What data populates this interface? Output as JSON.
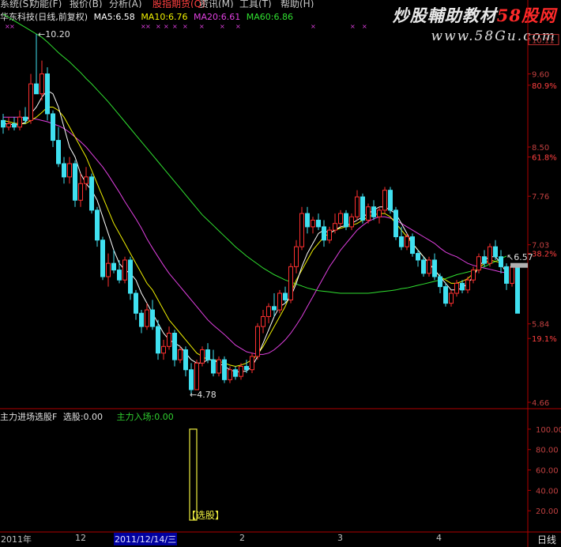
{
  "menu": [
    {
      "label": "系统",
      "x": 0
    },
    {
      "label": "功能",
      "x": 38
    },
    {
      "label": "报价",
      "x": 88
    },
    {
      "label": "分析",
      "x": 138
    },
    {
      "label": "股指期货",
      "x": 193,
      "active": true
    },
    {
      "label": "资讯",
      "x": 252
    },
    {
      "label": "工具",
      "x": 303
    },
    {
      "label": "帮助",
      "x": 355
    }
  ],
  "watermark": {
    "line1_a": "炒股輔助教材",
    "line1_b": "58股网",
    "line2": "www.58Gu.com"
  },
  "header": {
    "title": "华东科技(日线,前复权)",
    "ma5": "MA5:6.58",
    "ma10": "MA10:6.76",
    "ma20": "MA20:6.61",
    "ma60": "MA60:6.86"
  },
  "colors": {
    "up": "#ff3030",
    "down": "#40e0f0",
    "ma5": "#ffffff",
    "ma10": "#f0f000",
    "ma20": "#e040e0",
    "ma60": "#30e030",
    "axis": "#b00000",
    "grid": "#5a0000",
    "ind_title": "#e0e0e0",
    "ind_green": "#30d030",
    "bar": "#f0f040"
  },
  "price_axis": [
    {
      "label": "10.11",
      "price": 10.11,
      "boxed": true
    },
    {
      "label": "9.60",
      "price": 9.6
    },
    {
      "label": "80.9%",
      "price": 9.43
    },
    {
      "label": "8.50",
      "price": 8.5
    },
    {
      "label": "61.8%",
      "price": 8.35
    },
    {
      "label": "7.76",
      "price": 7.76
    },
    {
      "label": "7.03",
      "price": 7.03
    },
    {
      "label": "38.2%",
      "price": 6.9
    },
    {
      "label": "5.84",
      "price": 5.84
    },
    {
      "label": "19.1%",
      "price": 5.62
    },
    {
      "label": "4.66",
      "price": 4.66
    }
  ],
  "annotations": {
    "high": "10.20",
    "low": "4.78",
    "last": "6.57"
  },
  "indicator": {
    "title": "主力进场选股F",
    "xuangu": "选股:0.00",
    "zhuli": "主力入场:0.00",
    "axis": [
      "100.00",
      "80.00",
      "60.00",
      "40.00",
      "20.00"
    ],
    "bar_label": "【选股】",
    "bar_value": 100
  },
  "date_axis": {
    "ticks": [
      {
        "label": "2011年",
        "x": 1
      },
      {
        "label": "12",
        "x": 95
      },
      {
        "label": "2",
        "x": 303
      },
      {
        "label": "3",
        "x": 427
      },
      {
        "label": "4",
        "x": 552
      }
    ],
    "selected": "2011/12/14/三",
    "period": "日线"
  },
  "chart_data": {
    "type": "candlestick",
    "y_range": [
      4.6,
      10.45
    ],
    "candles": [
      {
        "o": 8.9,
        "h": 9.0,
        "l": 8.7,
        "c": 8.8
      },
      {
        "o": 8.8,
        "h": 8.95,
        "l": 8.75,
        "c": 8.85
      },
      {
        "o": 8.85,
        "h": 8.95,
        "l": 8.75,
        "c": 8.8
      },
      {
        "o": 8.8,
        "h": 9.05,
        "l": 8.75,
        "c": 8.95
      },
      {
        "o": 8.95,
        "h": 9.1,
        "l": 8.85,
        "c": 8.9
      },
      {
        "o": 8.9,
        "h": 9.6,
        "l": 8.85,
        "c": 9.45
      },
      {
        "o": 9.45,
        "h": 10.2,
        "l": 9.3,
        "c": 9.3
      },
      {
        "o": 9.3,
        "h": 9.8,
        "l": 9.2,
        "c": 9.6
      },
      {
        "o": 9.6,
        "h": 9.7,
        "l": 8.9,
        "c": 9.0
      },
      {
        "o": 9.0,
        "h": 9.05,
        "l": 8.5,
        "c": 8.6
      },
      {
        "o": 8.6,
        "h": 8.8,
        "l": 8.2,
        "c": 8.25
      },
      {
        "o": 8.25,
        "h": 8.35,
        "l": 7.95,
        "c": 8.05
      },
      {
        "o": 8.05,
        "h": 8.35,
        "l": 7.95,
        "c": 8.25
      },
      {
        "o": 8.25,
        "h": 8.3,
        "l": 7.6,
        "c": 7.7
      },
      {
        "o": 7.7,
        "h": 8.1,
        "l": 7.6,
        "c": 7.95
      },
      {
        "o": 7.95,
        "h": 8.2,
        "l": 7.85,
        "c": 8.05
      },
      {
        "o": 8.05,
        "h": 8.1,
        "l": 7.5,
        "c": 7.55
      },
      {
        "o": 7.55,
        "h": 7.6,
        "l": 7.0,
        "c": 7.1
      },
      {
        "o": 7.1,
        "h": 7.15,
        "l": 6.5,
        "c": 6.55
      },
      {
        "o": 6.55,
        "h": 6.9,
        "l": 6.4,
        "c": 6.75
      },
      {
        "o": 6.75,
        "h": 6.95,
        "l": 6.6,
        "c": 6.65
      },
      {
        "o": 6.65,
        "h": 6.8,
        "l": 6.45,
        "c": 6.5
      },
      {
        "o": 6.5,
        "h": 6.85,
        "l": 6.45,
        "c": 6.8
      },
      {
        "o": 6.8,
        "h": 6.85,
        "l": 6.2,
        "c": 6.3
      },
      {
        "o": 6.3,
        "h": 6.35,
        "l": 5.9,
        "c": 6.0
      },
      {
        "o": 6.0,
        "h": 6.05,
        "l": 5.7,
        "c": 5.8
      },
      {
        "o": 5.8,
        "h": 6.15,
        "l": 5.75,
        "c": 6.05
      },
      {
        "o": 6.05,
        "h": 6.2,
        "l": 5.75,
        "c": 5.8
      },
      {
        "o": 5.8,
        "h": 5.9,
        "l": 5.3,
        "c": 5.4
      },
      {
        "o": 5.4,
        "h": 5.6,
        "l": 5.3,
        "c": 5.5
      },
      {
        "o": 5.5,
        "h": 5.8,
        "l": 5.45,
        "c": 5.7
      },
      {
        "o": 5.7,
        "h": 5.75,
        "l": 5.2,
        "c": 5.3
      },
      {
        "o": 5.3,
        "h": 5.5,
        "l": 5.25,
        "c": 5.45
      },
      {
        "o": 5.45,
        "h": 5.5,
        "l": 5.05,
        "c": 5.15
      },
      {
        "o": 5.15,
        "h": 5.25,
        "l": 4.78,
        "c": 4.85
      },
      {
        "o": 4.85,
        "h": 5.3,
        "l": 4.85,
        "c": 5.25
      },
      {
        "o": 5.25,
        "h": 5.5,
        "l": 5.2,
        "c": 5.45
      },
      {
        "o": 5.45,
        "h": 5.55,
        "l": 5.25,
        "c": 5.3
      },
      {
        "o": 5.3,
        "h": 5.45,
        "l": 5.05,
        "c": 5.1
      },
      {
        "o": 5.1,
        "h": 5.35,
        "l": 5.05,
        "c": 5.3
      },
      {
        "o": 5.3,
        "h": 5.35,
        "l": 4.95,
        "c": 5.0
      },
      {
        "o": 5.0,
        "h": 5.2,
        "l": 4.95,
        "c": 5.15
      },
      {
        "o": 5.15,
        "h": 5.2,
        "l": 5.0,
        "c": 5.05
      },
      {
        "o": 5.05,
        "h": 5.25,
        "l": 5.0,
        "c": 5.2
      },
      {
        "o": 5.2,
        "h": 5.3,
        "l": 5.1,
        "c": 5.15
      },
      {
        "o": 5.15,
        "h": 5.4,
        "l": 5.1,
        "c": 5.35
      },
      {
        "o": 5.35,
        "h": 5.85,
        "l": 5.3,
        "c": 5.8
      },
      {
        "o": 5.8,
        "h": 6.05,
        "l": 5.7,
        "c": 5.95
      },
      {
        "o": 5.95,
        "h": 6.15,
        "l": 5.85,
        "c": 6.1
      },
      {
        "o": 6.1,
        "h": 6.3,
        "l": 5.95,
        "c": 6.05
      },
      {
        "o": 6.05,
        "h": 6.35,
        "l": 6.0,
        "c": 6.3
      },
      {
        "o": 6.3,
        "h": 6.4,
        "l": 6.15,
        "c": 6.2
      },
      {
        "o": 6.2,
        "h": 6.75,
        "l": 6.15,
        "c": 6.7
      },
      {
        "o": 6.7,
        "h": 7.1,
        "l": 6.6,
        "c": 7.0
      },
      {
        "o": 7.0,
        "h": 7.6,
        "l": 6.95,
        "c": 7.5
      },
      {
        "o": 7.5,
        "h": 7.6,
        "l": 7.2,
        "c": 7.3
      },
      {
        "o": 7.3,
        "h": 7.45,
        "l": 7.2,
        "c": 7.4
      },
      {
        "o": 7.4,
        "h": 7.5,
        "l": 7.25,
        "c": 7.3
      },
      {
        "o": 7.3,
        "h": 7.4,
        "l": 7.0,
        "c": 7.1
      },
      {
        "o": 7.1,
        "h": 7.3,
        "l": 7.05,
        "c": 7.25
      },
      {
        "o": 7.25,
        "h": 7.5,
        "l": 7.2,
        "c": 7.35
      },
      {
        "o": 7.35,
        "h": 7.55,
        "l": 7.3,
        "c": 7.5
      },
      {
        "o": 7.5,
        "h": 7.55,
        "l": 7.25,
        "c": 7.3
      },
      {
        "o": 7.3,
        "h": 7.5,
        "l": 7.25,
        "c": 7.45
      },
      {
        "o": 7.45,
        "h": 7.85,
        "l": 7.4,
        "c": 7.75
      },
      {
        "o": 7.75,
        "h": 7.8,
        "l": 7.35,
        "c": 7.4
      },
      {
        "o": 7.4,
        "h": 7.65,
        "l": 7.35,
        "c": 7.6
      },
      {
        "o": 7.6,
        "h": 7.7,
        "l": 7.4,
        "c": 7.45
      },
      {
        "o": 7.45,
        "h": 7.6,
        "l": 7.35,
        "c": 7.55
      },
      {
        "o": 7.55,
        "h": 7.9,
        "l": 7.5,
        "c": 7.85
      },
      {
        "o": 7.85,
        "h": 7.9,
        "l": 7.5,
        "c": 7.55
      },
      {
        "o": 7.55,
        "h": 7.6,
        "l": 7.1,
        "c": 7.15
      },
      {
        "o": 7.15,
        "h": 7.3,
        "l": 6.95,
        "c": 7.0
      },
      {
        "o": 7.0,
        "h": 7.2,
        "l": 6.95,
        "c": 7.15
      },
      {
        "o": 7.15,
        "h": 7.2,
        "l": 6.85,
        "c": 6.9
      },
      {
        "o": 6.9,
        "h": 6.95,
        "l": 6.7,
        "c": 6.8
      },
      {
        "o": 6.8,
        "h": 6.85,
        "l": 6.55,
        "c": 6.6
      },
      {
        "o": 6.6,
        "h": 6.85,
        "l": 6.55,
        "c": 6.8
      },
      {
        "o": 6.8,
        "h": 6.9,
        "l": 6.5,
        "c": 6.55
      },
      {
        "o": 6.55,
        "h": 6.6,
        "l": 6.3,
        "c": 6.4
      },
      {
        "o": 6.4,
        "h": 6.45,
        "l": 6.1,
        "c": 6.15
      },
      {
        "o": 6.15,
        "h": 6.35,
        "l": 6.1,
        "c": 6.3
      },
      {
        "o": 6.3,
        "h": 6.5,
        "l": 6.25,
        "c": 6.45
      },
      {
        "o": 6.45,
        "h": 6.5,
        "l": 6.3,
        "c": 6.35
      },
      {
        "o": 6.35,
        "h": 6.55,
        "l": 6.3,
        "c": 6.5
      },
      {
        "o": 6.5,
        "h": 6.7,
        "l": 6.45,
        "c": 6.65
      },
      {
        "o": 6.65,
        "h": 6.9,
        "l": 6.6,
        "c": 6.85
      },
      {
        "o": 6.85,
        "h": 6.95,
        "l": 6.7,
        "c": 6.75
      },
      {
        "o": 6.75,
        "h": 7.05,
        "l": 6.7,
        "c": 7.0
      },
      {
        "o": 7.0,
        "h": 7.1,
        "l": 6.8,
        "c": 6.85
      },
      {
        "o": 6.85,
        "h": 6.95,
        "l": 6.6,
        "c": 6.7
      },
      {
        "o": 6.7,
        "h": 6.75,
        "l": 6.35,
        "c": 6.45
      },
      {
        "o": 6.45,
        "h": 6.75,
        "l": 6.4,
        "c": 6.7
      },
      {
        "o": 6.7,
        "h": 6.75,
        "l": 6.0,
        "c": 6.0
      }
    ],
    "ma5": [
      8.85,
      8.85,
      8.83,
      8.84,
      8.87,
      9.0,
      9.1,
      9.25,
      9.35,
      9.3,
      9.1,
      8.8,
      8.5,
      8.35,
      8.1,
      7.95,
      7.85,
      7.7,
      7.45,
      7.2,
      6.95,
      6.75,
      6.65,
      6.6,
      6.5,
      6.3,
      6.15,
      6.0,
      5.85,
      5.7,
      5.6,
      5.55,
      5.5,
      5.4,
      5.3,
      5.25,
      5.25,
      5.3,
      5.3,
      5.25,
      5.2,
      5.15,
      5.12,
      5.12,
      5.13,
      5.2,
      5.35,
      5.55,
      5.75,
      5.95,
      6.1,
      6.15,
      6.25,
      6.45,
      6.7,
      6.9,
      7.05,
      7.2,
      7.25,
      7.2,
      7.25,
      7.3,
      7.32,
      7.35,
      7.4,
      7.45,
      7.5,
      7.55,
      7.6,
      7.6,
      7.55,
      7.5,
      7.35,
      7.2,
      7.05,
      6.95,
      6.85,
      6.75,
      6.65,
      6.55,
      6.45,
      6.35,
      6.35,
      6.38,
      6.45,
      6.55,
      6.7,
      6.8,
      6.85,
      6.85,
      6.75,
      6.6
    ],
    "ma10": [
      8.9,
      8.88,
      8.86,
      8.85,
      8.85,
      8.9,
      8.95,
      9.02,
      9.1,
      9.1,
      9.05,
      8.95,
      8.8,
      8.65,
      8.5,
      8.35,
      8.15,
      7.95,
      7.75,
      7.55,
      7.35,
      7.2,
      7.05,
      6.9,
      6.75,
      6.6,
      6.45,
      6.35,
      6.2,
      6.05,
      5.9,
      5.8,
      5.7,
      5.6,
      5.5,
      5.4,
      5.35,
      5.3,
      5.3,
      5.28,
      5.25,
      5.22,
      5.2,
      5.22,
      5.25,
      5.3,
      5.38,
      5.5,
      5.65,
      5.8,
      5.95,
      6.1,
      6.3,
      6.5,
      6.65,
      6.8,
      6.95,
      7.05,
      7.15,
      7.2,
      7.25,
      7.28,
      7.3,
      7.32,
      7.35,
      7.4,
      7.45,
      7.48,
      7.5,
      7.5,
      7.45,
      7.35,
      7.25,
      7.15,
      7.05,
      6.95,
      6.85,
      6.75,
      6.65,
      6.55,
      6.5,
      6.45,
      6.45,
      6.48,
      6.52,
      6.6,
      6.68,
      6.75,
      6.8,
      6.78,
      6.76
    ],
    "ma20": [
      8.95,
      8.95,
      8.95,
      8.95,
      8.94,
      8.93,
      8.92,
      8.9,
      8.88,
      8.85,
      8.82,
      8.78,
      8.72,
      8.65,
      8.58,
      8.5,
      8.4,
      8.3,
      8.2,
      8.08,
      7.95,
      7.82,
      7.68,
      7.55,
      7.42,
      7.28,
      7.12,
      6.98,
      6.85,
      6.72,
      6.6,
      6.5,
      6.4,
      6.3,
      6.2,
      6.1,
      6.0,
      5.9,
      5.82,
      5.75,
      5.68,
      5.6,
      5.52,
      5.47,
      5.42,
      5.4,
      5.38,
      5.38,
      5.4,
      5.45,
      5.52,
      5.6,
      5.7,
      5.82,
      5.95,
      6.1,
      6.25,
      6.4,
      6.55,
      6.7,
      6.82,
      6.95,
      7.05,
      7.15,
      7.25,
      7.32,
      7.38,
      7.42,
      7.45,
      7.45,
      7.43,
      7.4,
      7.35,
      7.3,
      7.25,
      7.2,
      7.15,
      7.1,
      7.05,
      6.98,
      6.92,
      6.88,
      6.85,
      6.8,
      6.75,
      6.72,
      6.7,
      6.68,
      6.66,
      6.64,
      6.62,
      6.61
    ],
    "ma60": [
      10.5,
      10.45,
      10.4,
      10.35,
      10.3,
      10.25,
      10.2,
      10.15,
      10.08,
      10.0,
      9.92,
      9.85,
      9.78,
      9.7,
      9.62,
      9.53,
      9.45,
      9.36,
      9.27,
      9.18,
      9.08,
      8.98,
      8.88,
      8.78,
      8.68,
      8.58,
      8.48,
      8.38,
      8.28,
      8.18,
      8.08,
      7.98,
      7.88,
      7.78,
      7.68,
      7.58,
      7.48,
      7.4,
      7.32,
      7.24,
      7.16,
      7.08,
      7.0,
      6.93,
      6.86,
      6.8,
      6.74,
      6.68,
      6.63,
      6.58,
      6.54,
      6.5,
      6.47,
      6.44,
      6.41,
      6.38,
      6.36,
      6.34,
      6.33,
      6.32,
      6.31,
      6.3,
      6.3,
      6.3,
      6.3,
      6.3,
      6.3,
      6.31,
      6.32,
      6.33,
      6.34,
      6.35,
      6.37,
      6.38,
      6.4,
      6.42,
      6.44,
      6.46,
      6.48,
      6.5,
      6.52,
      6.55,
      6.58,
      6.6,
      6.62,
      6.64,
      6.67,
      6.7,
      6.74,
      6.78,
      6.82,
      6.86
    ]
  }
}
